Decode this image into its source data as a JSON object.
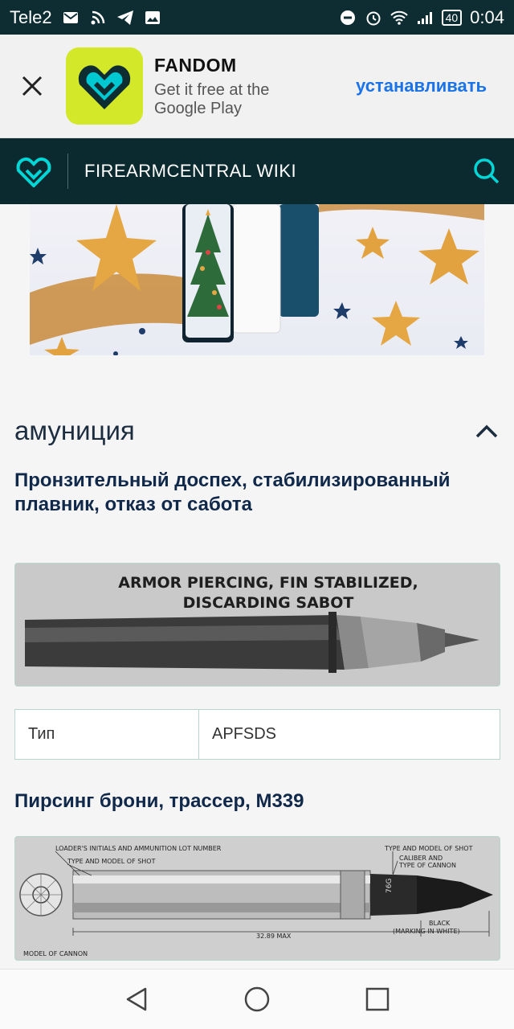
{
  "status_bar": {
    "carrier": "Tele2",
    "battery": "40",
    "time": "0:04"
  },
  "app_banner": {
    "app_name": "FANDOM",
    "subtitle": "Get it free at the Google Play",
    "install_label": "устанавливать"
  },
  "wiki_header": {
    "title": "FIREARMCENTRAL WIKI"
  },
  "section": {
    "title": "амуниция"
  },
  "items": [
    {
      "heading": "Пронзительный доспех, стабилизированный плавник, отказ от сабота",
      "caption_line1": "ARMOR PIERCING, FIN STABILIZED,",
      "caption_line2": "DISCARDING SABOT",
      "table_label": "Тип",
      "table_value": "APFSDS"
    },
    {
      "heading": "Пирсинг брони, трассер, M339",
      "labels": {
        "loader": "LOADER'S INITIALS AND AMMUNITION LOT NUMBER",
        "type_left": "TYPE AND MODEL OF SHOT",
        "type_right": "TYPE AND MODEL OF SHOT",
        "caliber": "CALIBER AND",
        "caliber2": "TYPE OF CANNON",
        "black": "BLACK",
        "marking": "(MARKING IN WHITE)",
        "max": "32.89 MAX",
        "model": "MODEL OF CANNON",
        "shell_text": "76G"
      }
    }
  ],
  "colors": {
    "header_bg": "#0b2a30",
    "accent": "#00d6d6",
    "link": "#1a73e8",
    "heading": "#10284a"
  }
}
